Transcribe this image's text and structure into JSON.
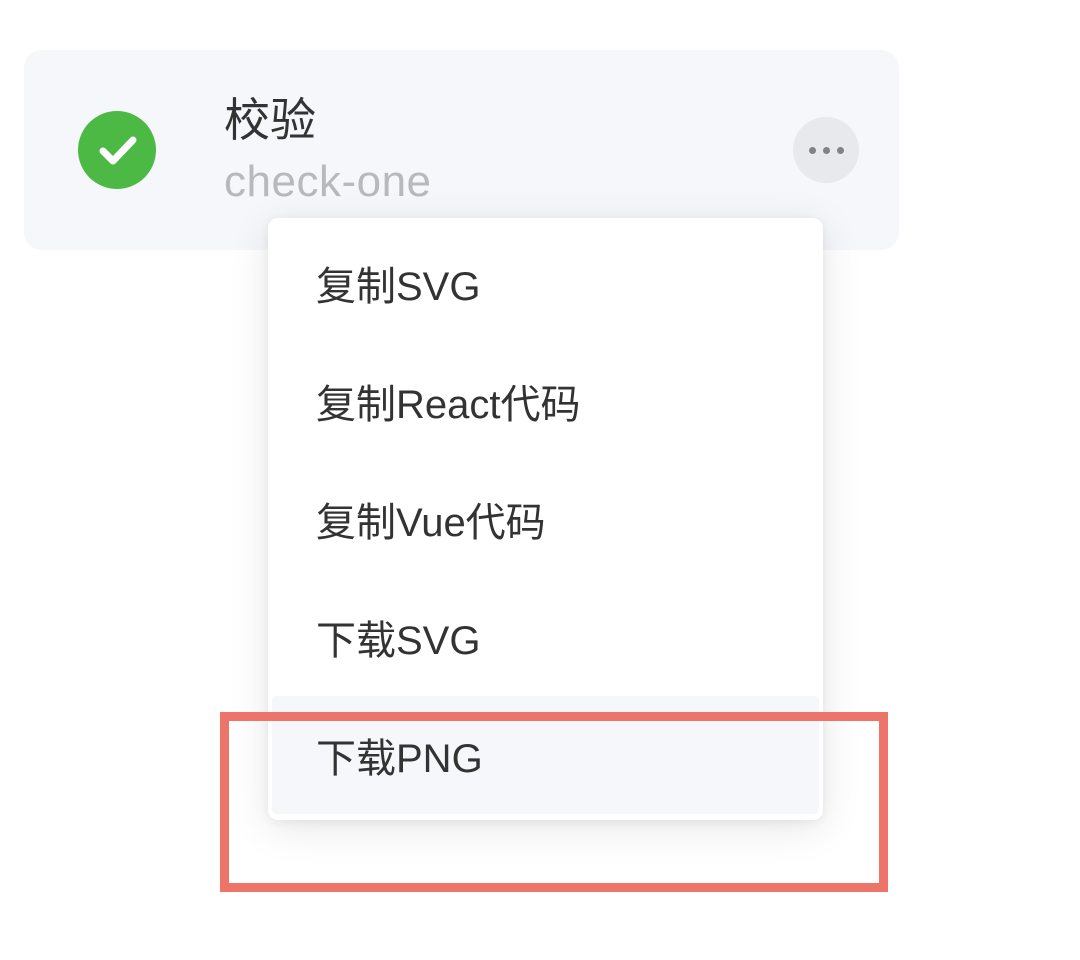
{
  "card": {
    "title_cn": "校验",
    "title_en": "check-one"
  },
  "menu": {
    "items": [
      {
        "label": "复制SVG",
        "highlight": false
      },
      {
        "label": "复制React代码",
        "highlight": false
      },
      {
        "label": "复制Vue代码",
        "highlight": false
      },
      {
        "label": "下载SVG",
        "highlight": false
      },
      {
        "label": "下载PNG",
        "highlight": true
      }
    ]
  }
}
